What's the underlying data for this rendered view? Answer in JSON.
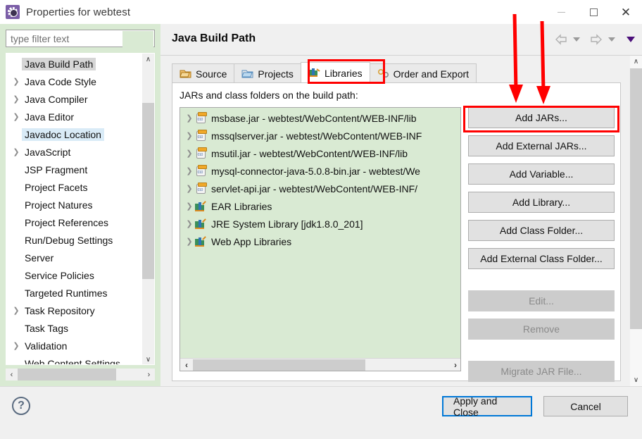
{
  "window": {
    "title": "Properties for webtest",
    "icon": "properties-gear-icon",
    "minimize_label": "—",
    "maximize_label": "",
    "close_label": "✕"
  },
  "nav": {
    "back_icon": "back-arrow-icon",
    "back_caret": "▼",
    "forward_icon": "forward-arrow-icon",
    "forward_caret": "▼",
    "menu_caret": "▼"
  },
  "sidebar": {
    "filter": {
      "placeholder": "type filter text",
      "value": ""
    },
    "items": [
      {
        "label": "Java Build Path",
        "expandable": false,
        "state": "selected-gray"
      },
      {
        "label": "Java Code Style",
        "expandable": true,
        "state": "normal"
      },
      {
        "label": "Java Compiler",
        "expandable": true,
        "state": "normal"
      },
      {
        "label": "Java Editor",
        "expandable": true,
        "state": "normal"
      },
      {
        "label": "Javadoc Location",
        "expandable": false,
        "state": "selected-blue"
      },
      {
        "label": "JavaScript",
        "expandable": true,
        "state": "normal"
      },
      {
        "label": "JSP Fragment",
        "expandable": false,
        "state": "normal"
      },
      {
        "label": "Project Facets",
        "expandable": false,
        "state": "normal"
      },
      {
        "label": "Project Natures",
        "expandable": false,
        "state": "normal"
      },
      {
        "label": "Project References",
        "expandable": false,
        "state": "normal"
      },
      {
        "label": "Run/Debug Settings",
        "expandable": false,
        "state": "normal"
      },
      {
        "label": "Server",
        "expandable": false,
        "state": "normal"
      },
      {
        "label": "Service Policies",
        "expandable": false,
        "state": "normal"
      },
      {
        "label": "Targeted Runtimes",
        "expandable": false,
        "state": "normal"
      },
      {
        "label": "Task Repository",
        "expandable": true,
        "state": "normal"
      },
      {
        "label": "Task Tags",
        "expandable": false,
        "state": "normal"
      },
      {
        "label": "Validation",
        "expandable": true,
        "state": "normal"
      },
      {
        "label": "Web Content Settings",
        "expandable": false,
        "state": "normal"
      }
    ],
    "scroll_up_icon": "∧",
    "scroll_down_icon": "∨",
    "scroll_left_icon": "‹",
    "scroll_right_icon": "›"
  },
  "main": {
    "page_title": "Java Build Path",
    "tabs": [
      {
        "label": "Source",
        "icon": "source-folder-icon",
        "active": false
      },
      {
        "label": "Projects",
        "icon": "projects-folder-icon",
        "active": false
      },
      {
        "label": "Libraries",
        "icon": "libraries-books-icon",
        "active": true
      },
      {
        "label": "Order and Export",
        "icon": "order-export-icon",
        "active": false
      }
    ],
    "panel_label": "JARs and class folders on the build path:",
    "entries": [
      {
        "label": "msbase.jar - webtest/WebContent/WEB-INF/lib",
        "icon": "jar-icon"
      },
      {
        "label": "mssqlserver.jar - webtest/WebContent/WEB-INF",
        "icon": "jar-icon"
      },
      {
        "label": "msutil.jar - webtest/WebContent/WEB-INF/lib",
        "icon": "jar-icon"
      },
      {
        "label": "mysql-connector-java-5.0.8-bin.jar - webtest/We",
        "icon": "jar-icon"
      },
      {
        "label": "servlet-api.jar - webtest/WebContent/WEB-INF/",
        "icon": "jar-icon"
      },
      {
        "label": "EAR Libraries",
        "icon": "library-icon"
      },
      {
        "label": "JRE System Library [jdk1.8.0_201]",
        "icon": "library-icon"
      },
      {
        "label": "Web App Libraries",
        "icon": "library-icon"
      }
    ],
    "buttons": [
      {
        "label": "Add JARs...",
        "enabled": true,
        "highlighted": true
      },
      {
        "label": "Add External JARs...",
        "enabled": true,
        "highlighted": false
      },
      {
        "label": "Add Variable...",
        "enabled": true,
        "highlighted": false
      },
      {
        "label": "Add Library...",
        "enabled": true,
        "highlighted": false
      },
      {
        "label": "Add Class Folder...",
        "enabled": true,
        "highlighted": false
      },
      {
        "label": "Add External Class Folder...",
        "enabled": true,
        "highlighted": false
      },
      {
        "label": "Edit...",
        "enabled": false,
        "highlighted": false
      },
      {
        "label": "Remove",
        "enabled": false,
        "highlighted": false
      },
      {
        "label": "Migrate JAR File...",
        "enabled": false,
        "highlighted": false
      }
    ],
    "scroll_left_icon": "‹",
    "scroll_right_icon": "›",
    "scroll_up_icon": "∧",
    "scroll_down_icon": "∨"
  },
  "footer": {
    "help_label": "?",
    "apply_and_close": "Apply and Close",
    "cancel": "Cancel"
  },
  "annotations": {
    "accent_color": "#ff0000",
    "tab_highlight_target": "Libraries",
    "button_highlight_target": "Add JARs...",
    "arrow_count": 2
  }
}
